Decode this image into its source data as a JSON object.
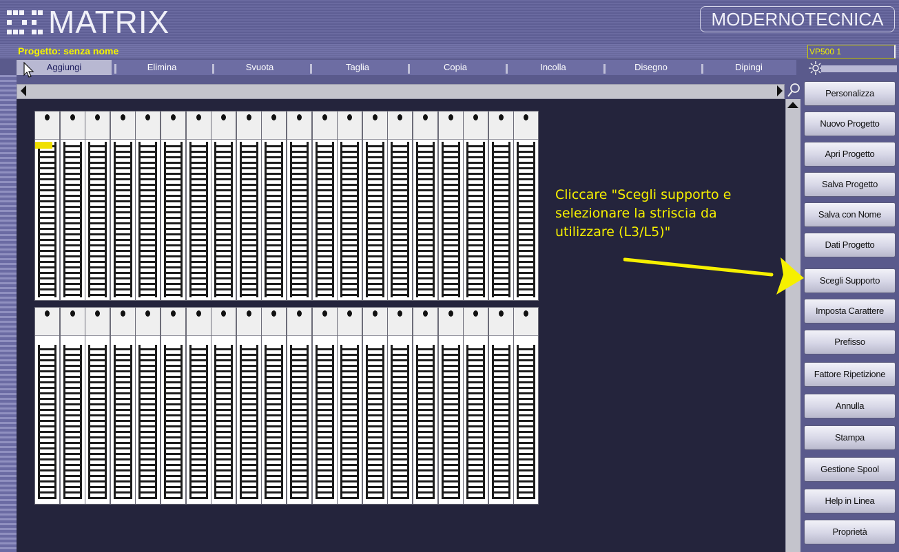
{
  "app": {
    "logo_text": "MATRIX",
    "brand": "MODERNOTECNICA"
  },
  "project": {
    "label": "Progetto: senza nome",
    "device_model": "VP500 1"
  },
  "tabs": [
    {
      "label": "Aggiungi",
      "active": true
    },
    {
      "label": "Elimina",
      "active": false
    },
    {
      "label": "Svuota",
      "active": false
    },
    {
      "label": "Taglia",
      "active": false
    },
    {
      "label": "Copia",
      "active": false
    },
    {
      "label": "Incolla",
      "active": false
    },
    {
      "label": "Disegno",
      "active": false
    },
    {
      "label": "Dipingi",
      "active": false
    }
  ],
  "side_buttons": [
    {
      "label": "Personalizza"
    },
    {
      "label": "Nuovo Progetto"
    },
    {
      "label": "Apri Progetto"
    },
    {
      "label": "Salva Progetto"
    },
    {
      "label": "Salva con Nome"
    },
    {
      "label": "Dati Progetto"
    },
    {
      "label": "Scegli Supporto"
    },
    {
      "label": "Imposta Carattere"
    },
    {
      "label": "Prefisso"
    },
    {
      "label": "Fattore Ripetizione"
    },
    {
      "label": "Annulla"
    },
    {
      "label": "Stampa"
    },
    {
      "label": "Gestione Spool"
    },
    {
      "label": "Help in Linea"
    },
    {
      "label": "Proprietà"
    }
  ],
  "annotation": {
    "lines": [
      "Cliccare \"Scegli supporto e",
      "selezionare la striscia da",
      "utilizzare (L3/L5)\""
    ]
  },
  "workspace": {
    "strip_rows": 2,
    "strips_per_row": 20
  },
  "colors": {
    "background": "#5a5a8c",
    "canvas": "#24243c",
    "highlight_text": "#f6f000",
    "active_tab": "#b8b8d2"
  },
  "icons": [
    "logo-dots-icon",
    "pointer-cursor-icon",
    "sun-icon",
    "scroll-left-icon",
    "scroll-right-icon",
    "zoom-icon",
    "scroll-up-icon",
    "annotation-arrow-icon"
  ]
}
